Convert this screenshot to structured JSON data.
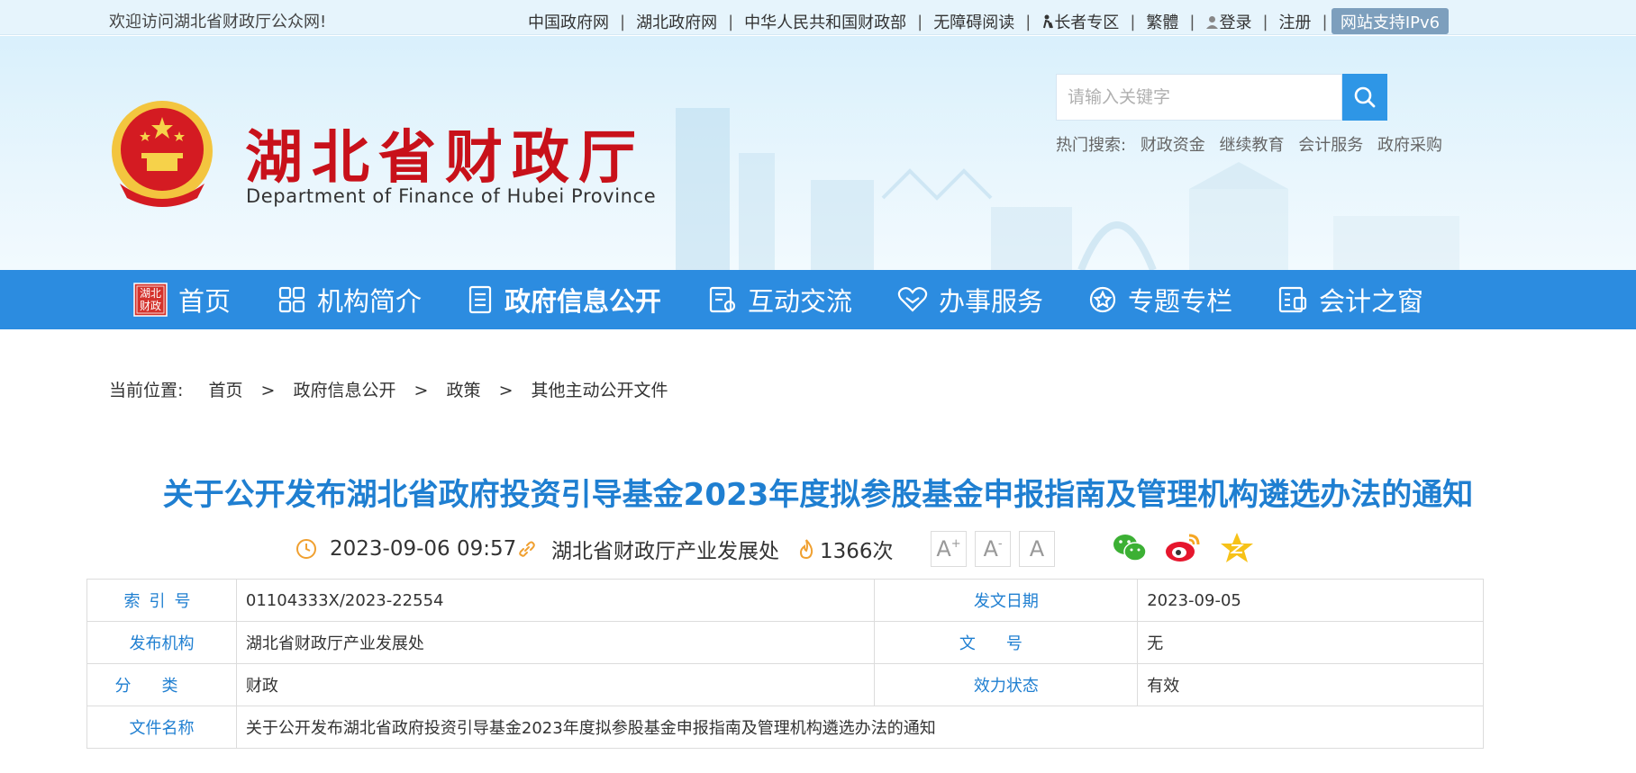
{
  "topbar": {
    "welcome": "欢迎访问湖北省财政厅公众网!",
    "links": [
      "中国政府网",
      "湖北政府网",
      "中华人民共和国财政部",
      "无障碍阅读",
      "长者专区",
      "繁體",
      "登录",
      "注册"
    ],
    "ipv6_label": "网站支持IPv6"
  },
  "header": {
    "title_cn": "湖北省财政厅",
    "title_en": "Department of Finance of Hubei Province",
    "search_placeholder": "请输入关键字",
    "hot_label": "热门搜索:",
    "hot_keywords": [
      "财政资金",
      "继续教育",
      "会计服务",
      "政府采购"
    ]
  },
  "nav": {
    "home_badge": "湖北财政",
    "items": [
      "首页",
      "机构简介",
      "政府信息公开",
      "互动交流",
      "办事服务",
      "专题专栏",
      "会计之窗"
    ],
    "active_index": 2
  },
  "breadcrumb": {
    "prefix": "当前位置:",
    "items": [
      "首页",
      "政府信息公开",
      "政策",
      "其他主动公开文件"
    ],
    "separator": ">"
  },
  "article": {
    "title": "关于公开发布湖北省政府投资引导基金2023年度拟参股基金申报指南及管理机构遴选办法的通知",
    "datetime": "2023-09-06 09:57",
    "source": "湖北省财政厅产业发展处",
    "views": "1366次",
    "font_controls": [
      "A",
      "A",
      "A"
    ]
  },
  "info_table": {
    "index_label": "索引号",
    "index_value": "01104333X/2023-22554",
    "date_label": "发文日期",
    "date_value": "2023-09-05",
    "publisher_label": "发布机构",
    "publisher_value": "湖北省财政厅产业发展处",
    "docno_label": "文号",
    "docno_value": "无",
    "category_label": "分类",
    "category_value": "财政",
    "status_label": "效力状态",
    "status_value": "有效",
    "filename_label": "文件名称",
    "filename_value": "关于公开发布湖北省政府投资引导基金2023年度拟参股基金申报指南及管理机构遴选办法的通知"
  },
  "colors": {
    "nav_bg": "#2c8ce0",
    "brand_red": "#c8111a",
    "title_blue": "#1f7fd1",
    "accent_orange": "#f0a030"
  }
}
